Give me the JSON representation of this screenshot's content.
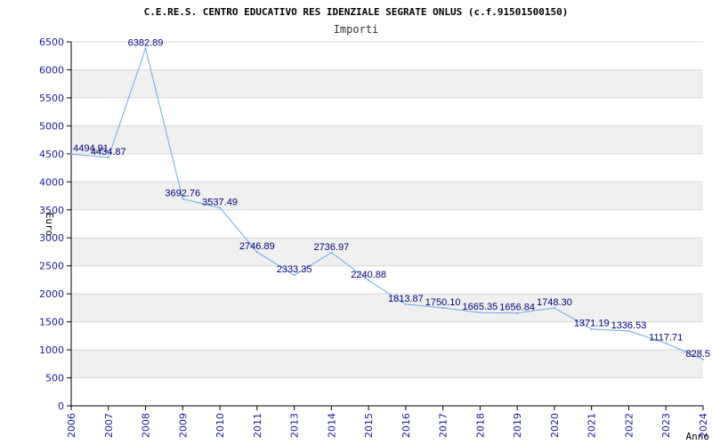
{
  "chart_data": {
    "type": "line",
    "title": "C.E.RE.S. CENTRO EDUCATIVO RES IDENZIALE SEGRATE ONLUS (c.f.91501500150)",
    "subtitle": "Importi",
    "xlabel": "Anno",
    "ylabel": "Euro",
    "categories": [
      "2006",
      "2007",
      "2008",
      "2009",
      "2010",
      "2011",
      "2013",
      "2014",
      "2015",
      "2016",
      "2017",
      "2018",
      "2019",
      "2020",
      "2021",
      "2022",
      "2023",
      "2024"
    ],
    "series": [
      {
        "values": [
          4494.91,
          4434.87,
          6382.89,
          3692.76,
          3537.49,
          2746.89,
          2333.35,
          2736.97,
          2240.88,
          1813.87,
          1750.1,
          1665.35,
          1656.84,
          1748.3,
          1371.19,
          1336.53,
          1117.71,
          828.5
        ],
        "labels": [
          "4494.91",
          "4434.87",
          "6382.89",
          "3692.76",
          "3537.49",
          "2746.89",
          "2333.35",
          "2736.97",
          "2240.88",
          "1813.87",
          "1750.10",
          "1665.35",
          "1656.84",
          "1748.30",
          "1371.19",
          "1336.53",
          "1117.71",
          "828.5"
        ]
      }
    ],
    "yticks": [
      "0",
      "500",
      "1000",
      "1500",
      "2000",
      "2500",
      "3000",
      "3500",
      "4000",
      "4500",
      "5000",
      "5500",
      "6000",
      "6500"
    ],
    "ylim": [
      0,
      6500
    ],
    "grid": true,
    "legend": "none",
    "colors": {
      "line": "#6aa8f0",
      "band": "#f0f0f0",
      "grid": "#d8d8d8",
      "tick_text": "#1a1aa6",
      "data_label": "#00007f"
    }
  }
}
